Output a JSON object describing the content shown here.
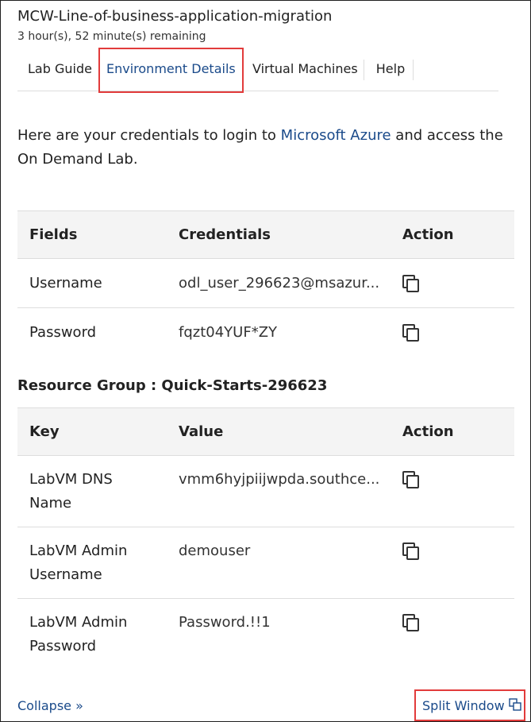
{
  "header": {
    "title": "MCW-Line-of-business-application-migration",
    "time_remaining": "3 hour(s), 52 minute(s) remaining"
  },
  "tabs": [
    {
      "label": "Lab Guide",
      "active": false
    },
    {
      "label": "Environment Details",
      "active": true
    },
    {
      "label": "Virtual Machines",
      "active": false
    },
    {
      "label": "Help",
      "active": false
    }
  ],
  "intro": {
    "before": "Here are your credentials to login to ",
    "link": "Microsoft Azure",
    "after": " and access the On Demand Lab."
  },
  "credentials_table": {
    "headers": [
      "Fields",
      "Credentials",
      "Action"
    ],
    "rows": [
      {
        "field": "Username",
        "value": "odl_user_296623@msazur..."
      },
      {
        "field": "Password",
        "value": "fqzt04YUF*ZY"
      }
    ]
  },
  "resource_group": {
    "label": "Resource Group : Quick-Starts-296623"
  },
  "resource_table": {
    "headers": [
      "Key",
      "Value",
      "Action"
    ],
    "rows": [
      {
        "key": "LabVM DNS Name",
        "value": "vmm6hyjpiijwpda.southce..."
      },
      {
        "key": "LabVM Admin Username",
        "value": "demouser"
      },
      {
        "key": "LabVM Admin Password",
        "value": "Password.!!1"
      }
    ]
  },
  "footer": {
    "collapse_label": "Collapse »",
    "split_window_label": "Split Window"
  },
  "icons": {
    "copy": "copy-icon",
    "split_window": "external-window-icon"
  },
  "colors": {
    "link": "#1a4a8a",
    "highlight": "#e23b3b",
    "header_bg": "#f4f4f4"
  }
}
